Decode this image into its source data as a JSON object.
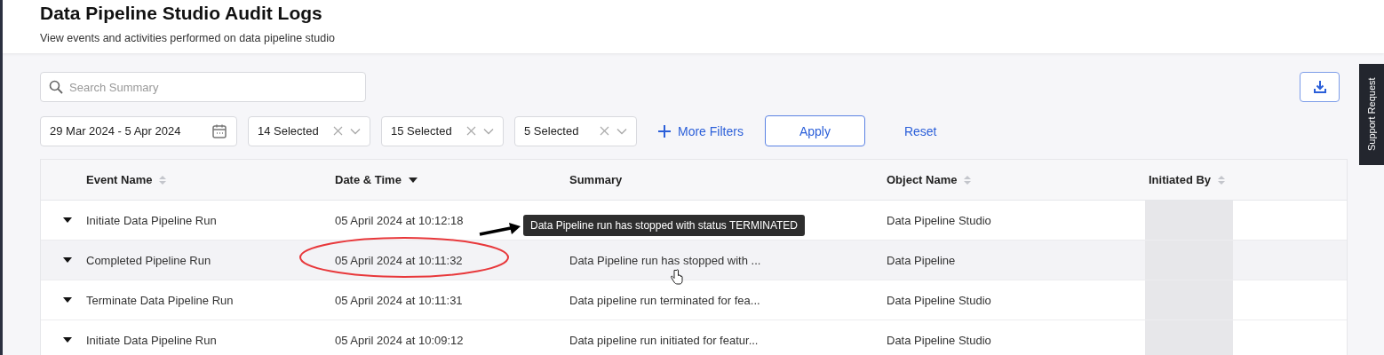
{
  "page": {
    "title": "Data Pipeline Studio Audit Logs",
    "subtitle": "View events and activities performed on data pipeline studio"
  },
  "search": {
    "placeholder": "Search Summary"
  },
  "date_range": {
    "value": "29 Mar 2024 - 5 Apr 2024"
  },
  "filters": [
    {
      "value": "14 Selected"
    },
    {
      "value": "15 Selected"
    },
    {
      "value": "5 Selected"
    }
  ],
  "more_filters": {
    "label": "More Filters"
  },
  "apply_button": {
    "label": "Apply"
  },
  "reset_link": {
    "label": "Reset"
  },
  "table": {
    "columns": [
      {
        "label": "Event Name",
        "kind": "sortable",
        "sorted": false
      },
      {
        "label": "Date & Time",
        "kind": "sortable",
        "sorted": true
      },
      {
        "label": "Summary",
        "kind": "plain",
        "sorted": false
      },
      {
        "label": "Object Name",
        "kind": "sortable",
        "sorted": false
      },
      {
        "label": "Initiated By",
        "kind": "sortable",
        "sorted": false
      }
    ],
    "rows": [
      {
        "expanded": false,
        "highlighted": false,
        "event_name": "Initiate Data Pipeline Run",
        "date_time": "05 April 2024 at 10:12:18",
        "object_name": "Data Pipeline Studio"
      },
      {
        "expanded": false,
        "highlighted": true,
        "event_name": "Completed Pipeline Run",
        "date_time": "05 April 2024 at 10:11:32",
        "summary": "Data Pipeline run has stopped with ...",
        "object_name": "Data Pipeline"
      },
      {
        "expanded": false,
        "highlighted": false,
        "event_name": "Terminate Data Pipeline Run",
        "date_time": "05 April 2024 at 10:11:31",
        "summary": "Data pipeline run terminated for fea...",
        "object_name": "Data Pipeline Studio"
      },
      {
        "expanded": false,
        "highlighted": false,
        "event_name": "Initiate Data Pipeline Run",
        "date_time": "05 April 2024 at 10:09:12",
        "summary": "Data pipeline run initiated for featur...",
        "object_name": "Data Pipeline Studio"
      }
    ]
  },
  "tooltip": {
    "text": "Data Pipeline run has stopped with status TERMINATED"
  },
  "support_tab": {
    "label": "Support Request"
  }
}
